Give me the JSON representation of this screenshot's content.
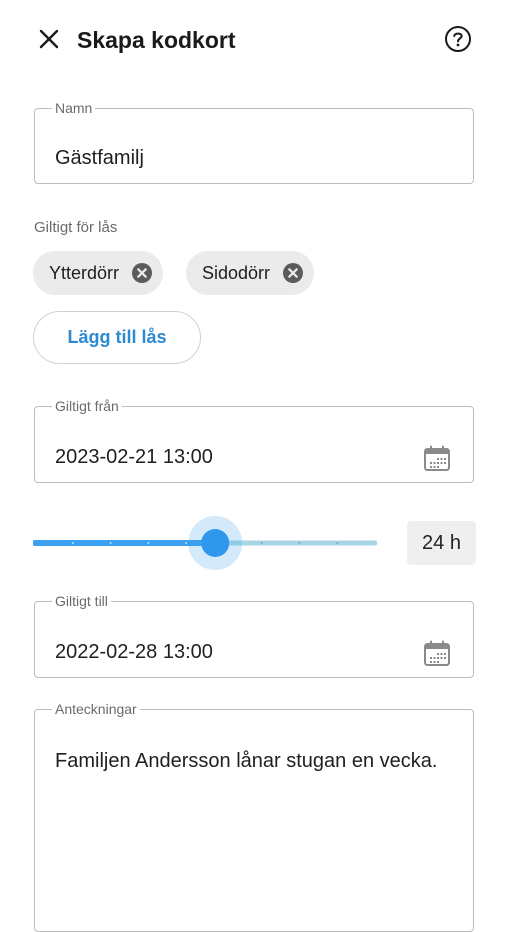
{
  "header": {
    "title": "Skapa kodkort",
    "close_icon": "close-icon",
    "help_icon": "help-circle-icon"
  },
  "name_field": {
    "label": "Namn",
    "value": "Gästfamilj"
  },
  "locks": {
    "label": "Giltigt för lås",
    "chips": [
      {
        "label": "Ytterdörr",
        "remove_icon": "cancel-circle-icon"
      },
      {
        "label": "Sidodörr",
        "remove_icon": "cancel-circle-icon"
      }
    ],
    "add_button_label": "Lägg till lås"
  },
  "valid_from": {
    "label": "Giltigt från",
    "value": "2023-02-21 13:00",
    "icon": "calendar-icon"
  },
  "duration": {
    "value_label": "24 h",
    "slider_fraction": 0.53,
    "accent": "#3aa0ef",
    "track_rest": "#a9d6e6"
  },
  "valid_to": {
    "label": "Giltigt till",
    "value": "2022-02-28 13:00",
    "icon": "calendar-icon"
  },
  "notes": {
    "label": "Anteckningar",
    "value": "Familjen Andersson lånar stugan en vecka."
  },
  "colors": {
    "accent": "#2c8ad3",
    "chip_bg": "#ebebeb",
    "border": "#bdbdbd"
  }
}
